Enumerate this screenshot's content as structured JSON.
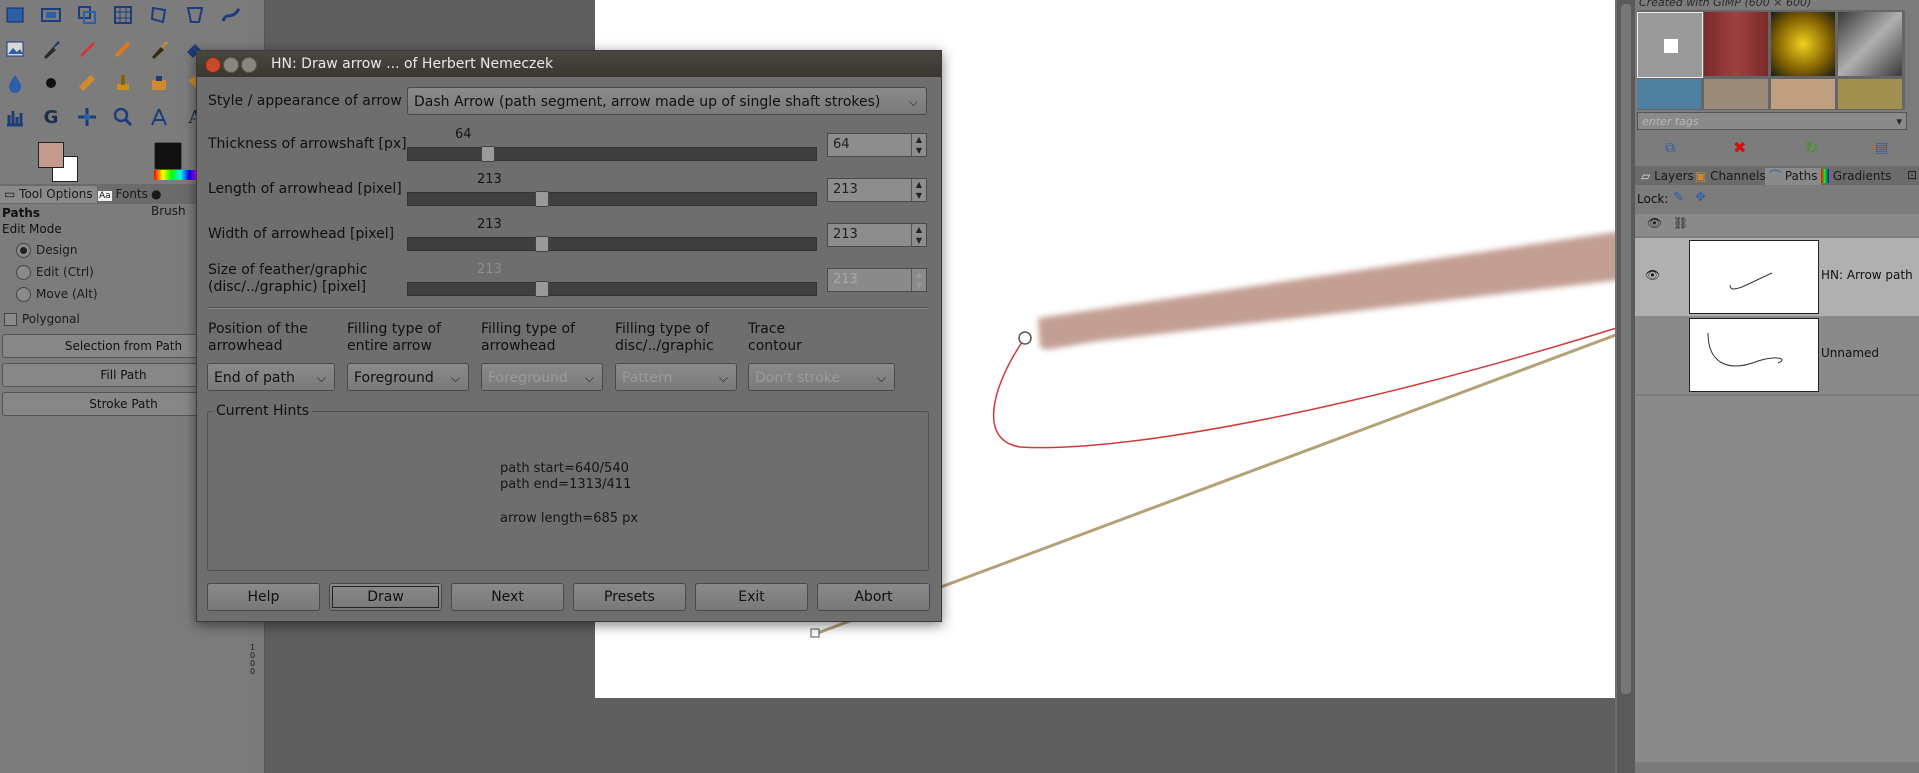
{
  "toolbox": {
    "tabs": [
      "Tool Options",
      "Fonts",
      "Brush"
    ],
    "tool_name": "Paths",
    "edit_mode_label": "Edit Mode",
    "modes": [
      "Design",
      "Edit (Ctrl)",
      "Move (Alt)"
    ],
    "polygonal_label": "Polygonal",
    "buttons": [
      "Selection from Path",
      "Fill Path",
      "Stroke Path"
    ],
    "fg_color": "#c49a8c",
    "bg_color": "#ffffff"
  },
  "ruler": {
    "ticks": "1000"
  },
  "dialog": {
    "title": "HN: Draw arrow ... of Herbert Nemeczek",
    "style_label": "Style / appearance of arrow",
    "style_value": "Dash Arrow (path segment, arrow made up of single shaft strokes)",
    "rows": [
      {
        "label": "Thickness of arrowshaft [px]",
        "value": "64",
        "spin": "64",
        "fraction": 0.064
      },
      {
        "label": "Length of arrowhead [pixel]",
        "value": "213",
        "spin": "213",
        "fraction": 0.2
      },
      {
        "label": "Width of arrowhead [pixel]",
        "value": "213",
        "spin": "213",
        "fraction": 0.2
      },
      {
        "label": "Size of feather/graphic",
        "label2": "(disc/../graphic) [pixel]",
        "value": "213",
        "spin": "213",
        "fraction": 0.2
      }
    ],
    "columns": [
      {
        "head": "Position of the",
        "head2": "arrowhead",
        "value": "End of path",
        "disabled": false
      },
      {
        "head": "Filling type of",
        "head2": "entire arrow",
        "value": "Foreground",
        "disabled": false
      },
      {
        "head": "Filling type of",
        "head2": "arrowhead",
        "value": "Foreground",
        "disabled": true
      },
      {
        "head": "Filling type of",
        "head2": "disc/../graphic",
        "value": "Pattern",
        "disabled": true
      },
      {
        "head": "Trace",
        "head2": "contour",
        "value": "Don't stroke",
        "disabled": true
      }
    ],
    "hints_title": "Current Hints",
    "hints": [
      "path start=640/540",
      "path end=1313/411",
      "arrow length=685 px"
    ],
    "buttons": [
      "Help",
      "Draw",
      "Next",
      "Presets",
      "Exit",
      "Abort"
    ]
  },
  "dock": {
    "header": "Created with GIMP (600 × 600)",
    "tags_placeholder": "enter tags",
    "tabs": [
      "Layers",
      "Channels",
      "Paths",
      "Gradients"
    ],
    "lock_label": "Lock:",
    "paths": [
      {
        "name": "HN: Arrow path"
      },
      {
        "name": "Unnamed"
      }
    ]
  },
  "canvas": {
    "arrow_color": "#c49a8c",
    "path_color": "#d23a3a",
    "guide_color": "#b3a178"
  }
}
